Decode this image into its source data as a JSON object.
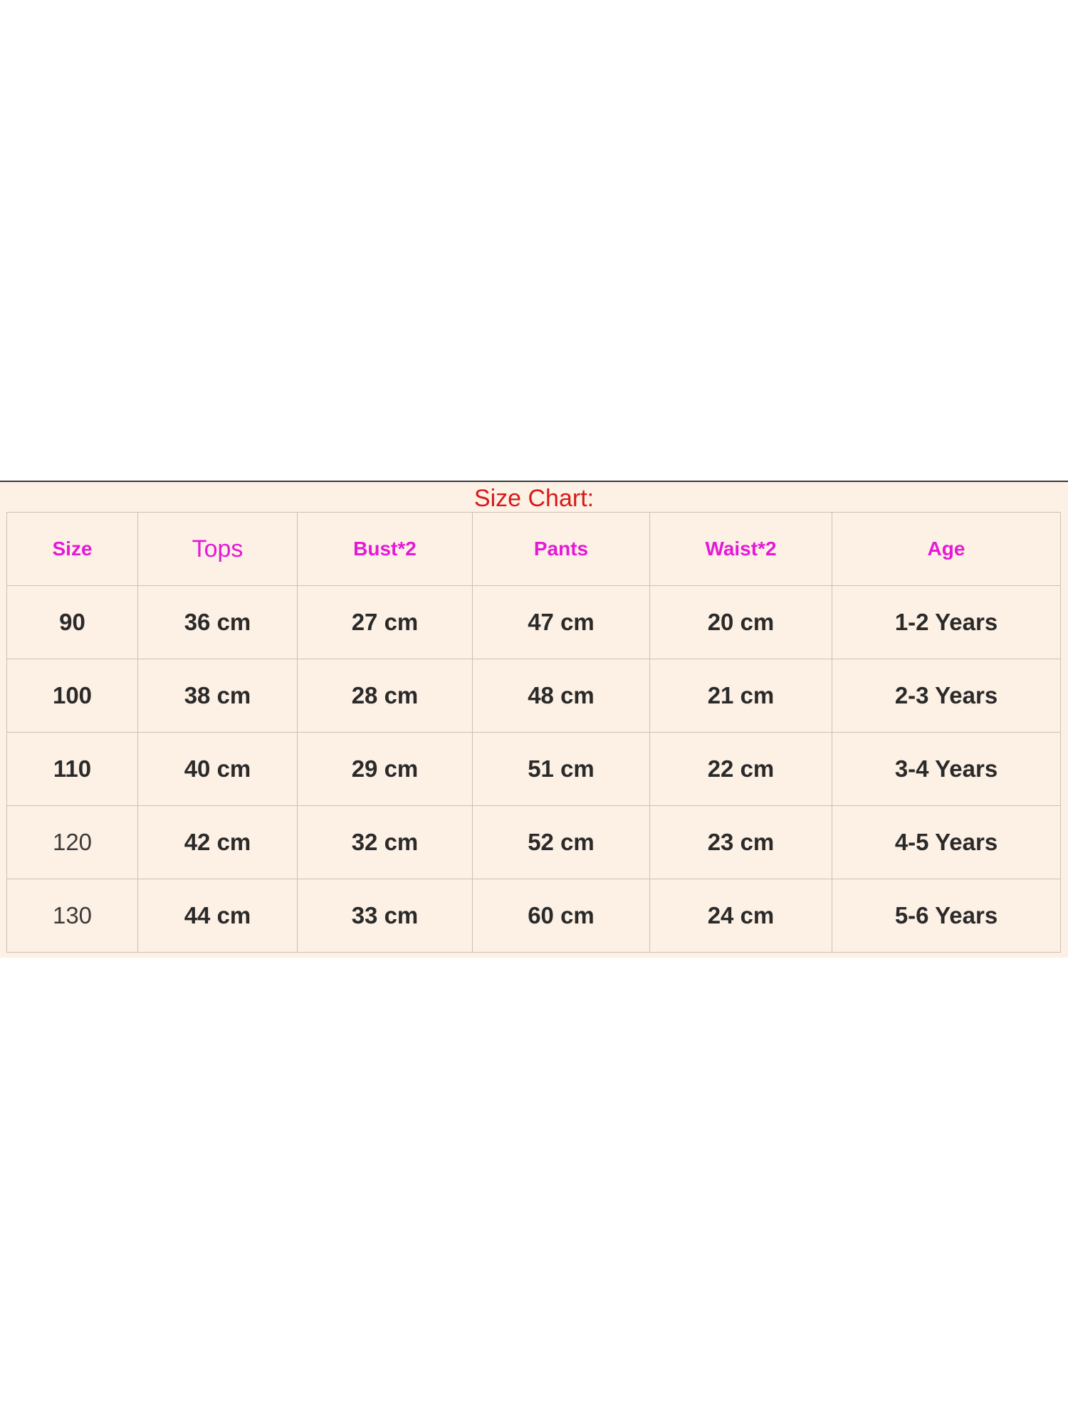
{
  "title": "Size Chart:",
  "colors": {
    "title": "#d51a1a",
    "header": "#e419d8",
    "cell_text": "#2a2a2a",
    "panel_background": "#fdf0e4",
    "grid_line": "#cdbfb4"
  },
  "table": {
    "headers": [
      "Size",
      "Tops",
      "Bust*2",
      "Pants",
      "Waist*2",
      "Age"
    ],
    "rows": [
      [
        "90",
        "36 cm",
        "27 cm",
        "47 cm",
        "20 cm",
        "1-2 Years"
      ],
      [
        "100",
        "38 cm",
        "28 cm",
        "48 cm",
        "21 cm",
        "2-3 Years"
      ],
      [
        "110",
        "40 cm",
        "29 cm",
        "51 cm",
        "22 cm",
        "3-4 Years"
      ],
      [
        "120",
        "42 cm",
        "32 cm",
        "52 cm",
        "23 cm",
        "4-5 Years"
      ],
      [
        "130",
        "44 cm",
        "33 cm",
        "60 cm",
        "24 cm",
        "5-6 Years"
      ]
    ]
  }
}
